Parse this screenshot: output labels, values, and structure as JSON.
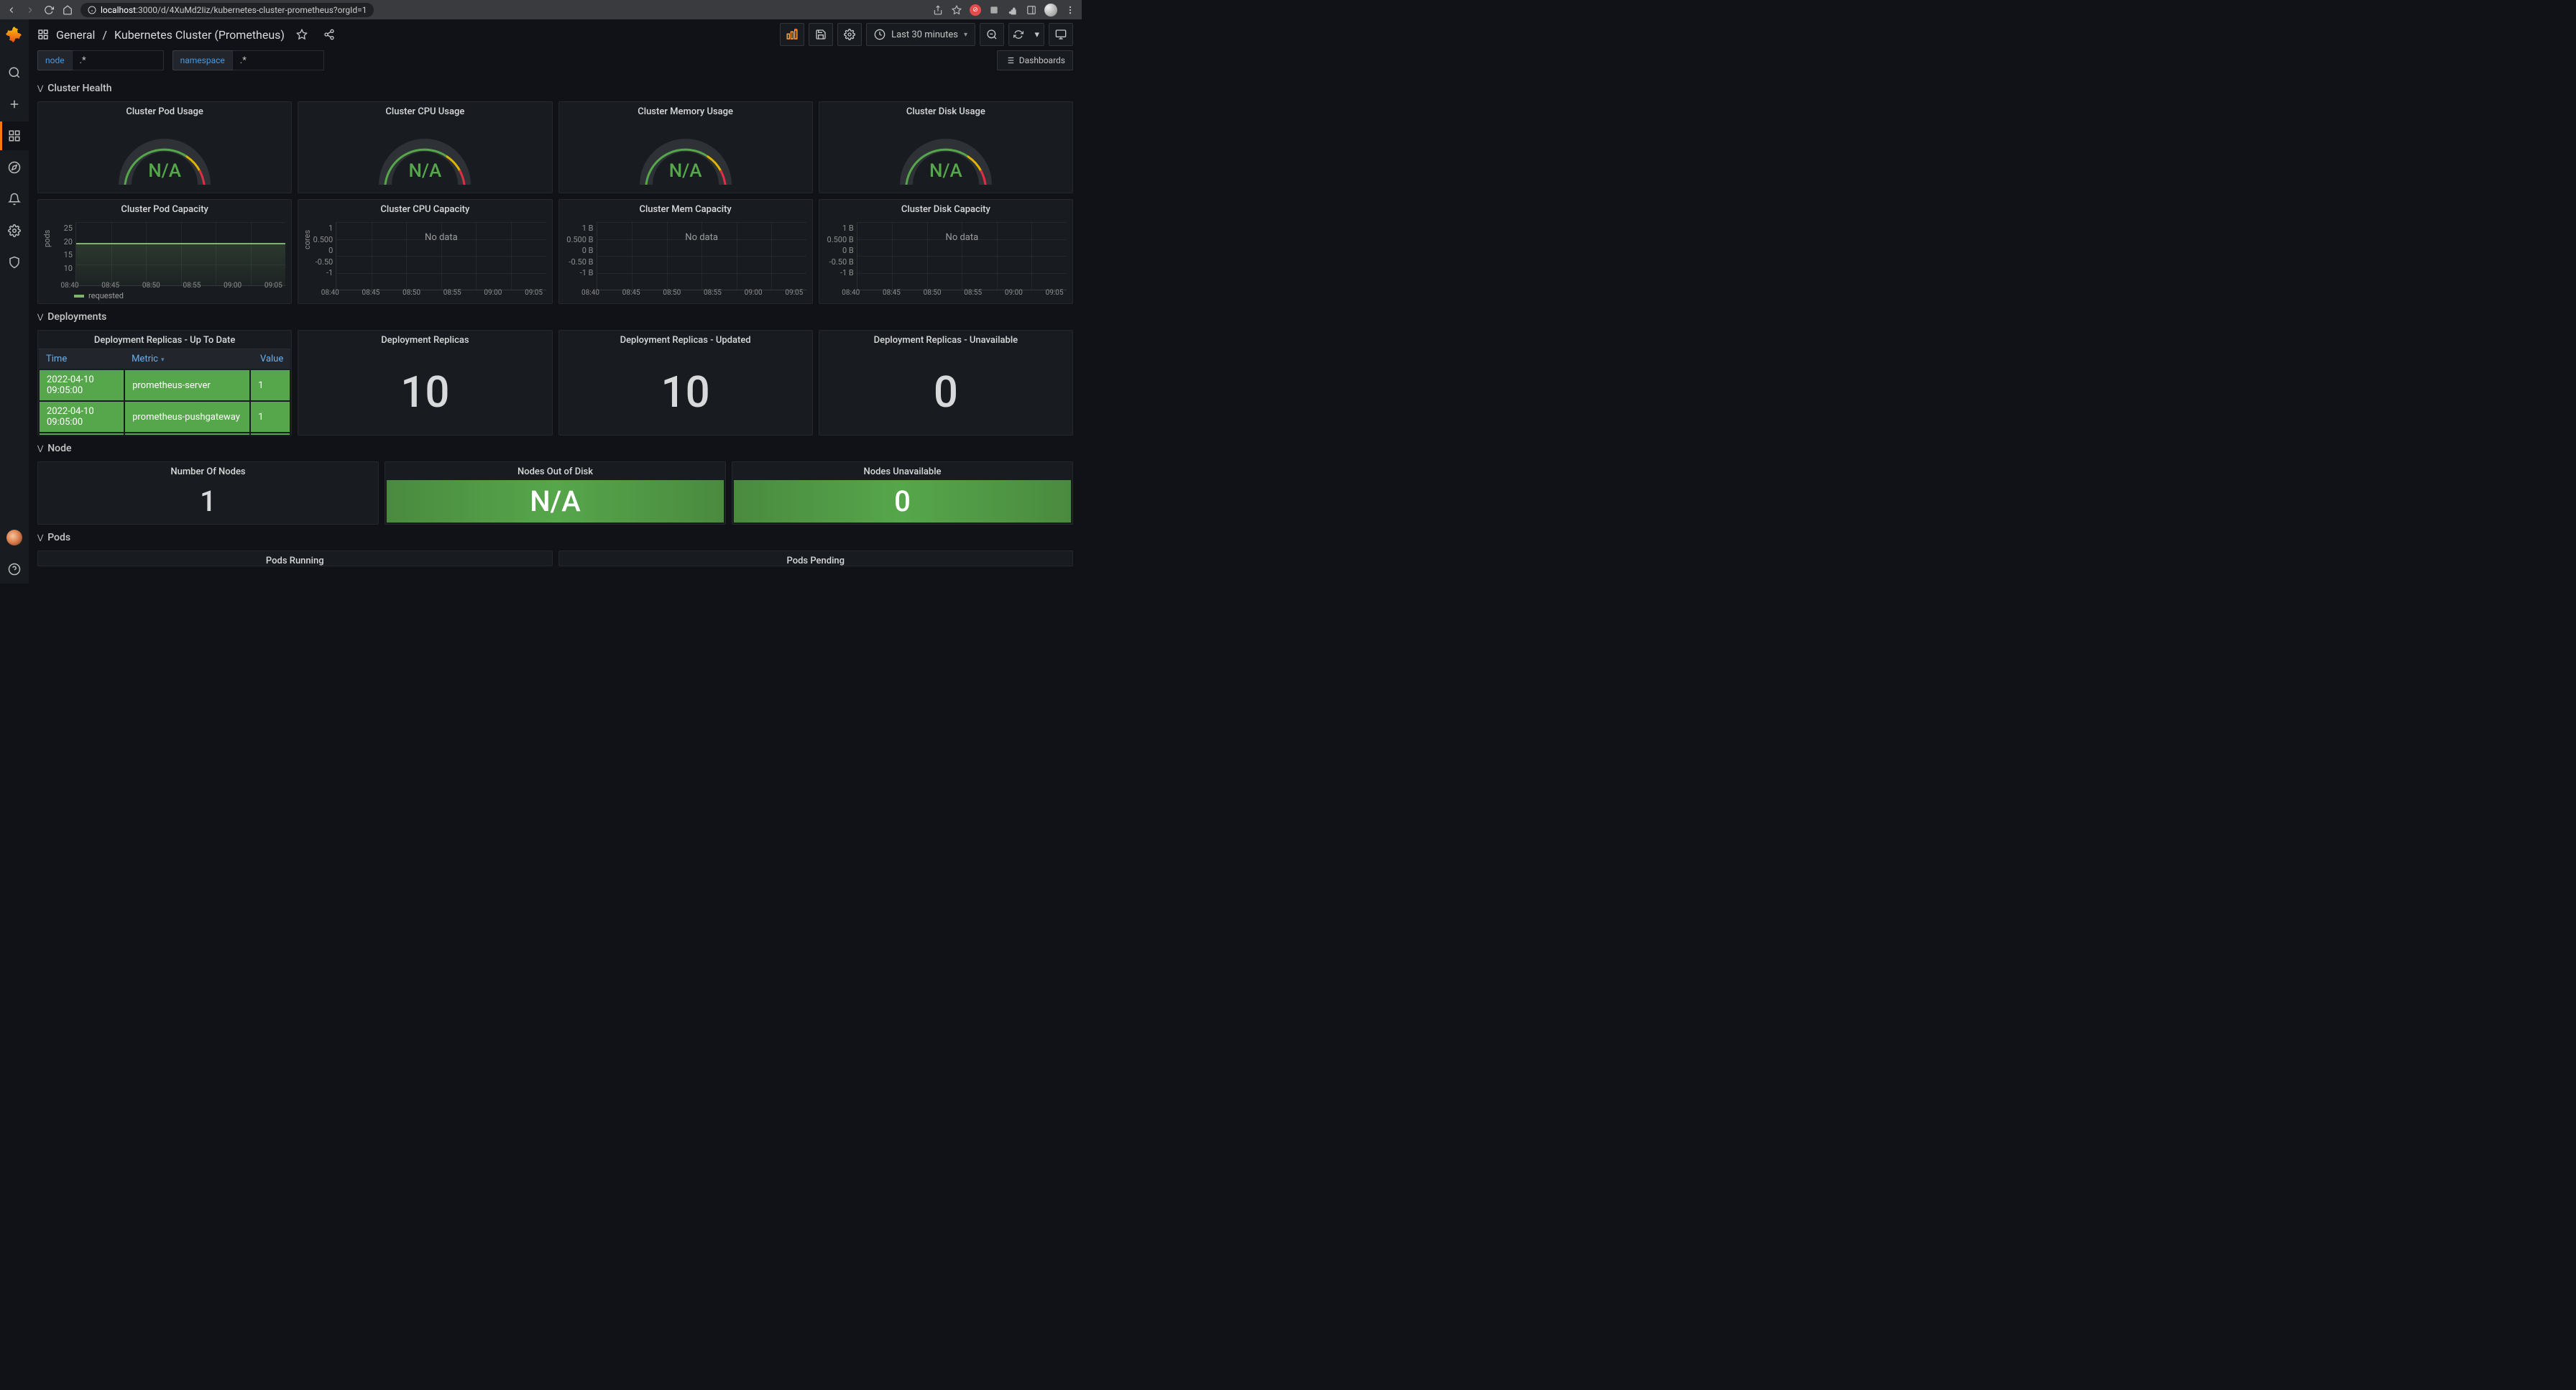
{
  "browser": {
    "url_prefix": "localhost",
    "url_rest": ":3000/d/4XuMd2Iiz/kubernetes-cluster-prometheus?orgId=1"
  },
  "breadcrumb": {
    "folder": "General",
    "title": "Kubernetes Cluster (Prometheus)"
  },
  "time_picker": "Last 30 minutes",
  "variables": [
    {
      "label": "node",
      "value": ".*"
    },
    {
      "label": "namespace",
      "value": ".*"
    }
  ],
  "dashboards_btn": "Dashboards",
  "rows": {
    "cluster_health": "Cluster Health",
    "deployments": "Deployments",
    "node": "Node",
    "pods": "Pods"
  },
  "usage_panels": [
    {
      "title": "Cluster Pod Usage",
      "value": "N/A"
    },
    {
      "title": "Cluster CPU Usage",
      "value": "N/A"
    },
    {
      "title": "Cluster Memory Usage",
      "value": "N/A"
    },
    {
      "title": "Cluster Disk Usage",
      "value": "N/A"
    }
  ],
  "capacity_panels": [
    {
      "title": "Cluster Pod Capacity",
      "ylabel": "pods",
      "yticks": [
        "25",
        "20",
        "15",
        "10"
      ],
      "xticks": [
        "08:40",
        "08:45",
        "08:50",
        "08:55",
        "09:00",
        "09:05"
      ],
      "nodata": false,
      "series_value": 20,
      "series_range": [
        10,
        25
      ],
      "legend": "requested"
    },
    {
      "title": "Cluster CPU Capacity",
      "ylabel": "cores",
      "yticks": [
        "1",
        "0.500",
        "0",
        "-0.50",
        "-1"
      ],
      "xticks": [
        "08:40",
        "08:45",
        "08:50",
        "08:55",
        "09:00",
        "09:05"
      ],
      "nodata": true
    },
    {
      "title": "Cluster Mem Capacity",
      "ylabel": "",
      "yticks": [
        "1 B",
        "0.500 B",
        "0 B",
        "-0.50 B",
        "-1 B"
      ],
      "xticks": [
        "08:40",
        "08:45",
        "08:50",
        "08:55",
        "09:00",
        "09:05"
      ],
      "nodata": true
    },
    {
      "title": "Cluster Disk Capacity",
      "ylabel": "",
      "yticks": [
        "1 B",
        "0.500 B",
        "0 B",
        "-0.50 B",
        "-1 B"
      ],
      "xticks": [
        "08:40",
        "08:45",
        "08:50",
        "08:55",
        "09:00",
        "09:05"
      ],
      "nodata": true
    }
  ],
  "deploy_table": {
    "title": "Deployment Replicas - Up To Date",
    "headers": [
      "Time",
      "Metric",
      "Value"
    ],
    "rows": [
      {
        "time": "2022-04-10 09:05:00",
        "metric": "prometheus-server",
        "value": "1"
      },
      {
        "time": "2022-04-10 09:05:00",
        "metric": "prometheus-pushgateway",
        "value": "1"
      }
    ]
  },
  "deploy_stats": [
    {
      "title": "Deployment Replicas",
      "value": "10"
    },
    {
      "title": "Deployment Replicas - Updated",
      "value": "10"
    },
    {
      "title": "Deployment Replicas - Unavailable",
      "value": "0"
    }
  ],
  "node_stats": [
    {
      "title": "Number Of Nodes",
      "value": "1",
      "green": false
    },
    {
      "title": "Nodes Out of Disk",
      "value": "N/A",
      "green": true
    },
    {
      "title": "Nodes Unavailable",
      "value": "0",
      "green": true
    }
  ],
  "pods_panels": [
    {
      "title": "Pods Running"
    },
    {
      "title": "Pods Pending"
    }
  ],
  "nodata_text": "No data",
  "chart_data": {
    "type": "line",
    "title": "Cluster Pod Capacity",
    "ylabel": "pods",
    "ylim": [
      10,
      25
    ],
    "x": [
      "08:40",
      "08:45",
      "08:50",
      "08:55",
      "09:00",
      "09:05"
    ],
    "series": [
      {
        "name": "requested",
        "values": [
          20,
          20,
          20,
          20,
          20,
          20
        ]
      }
    ]
  }
}
